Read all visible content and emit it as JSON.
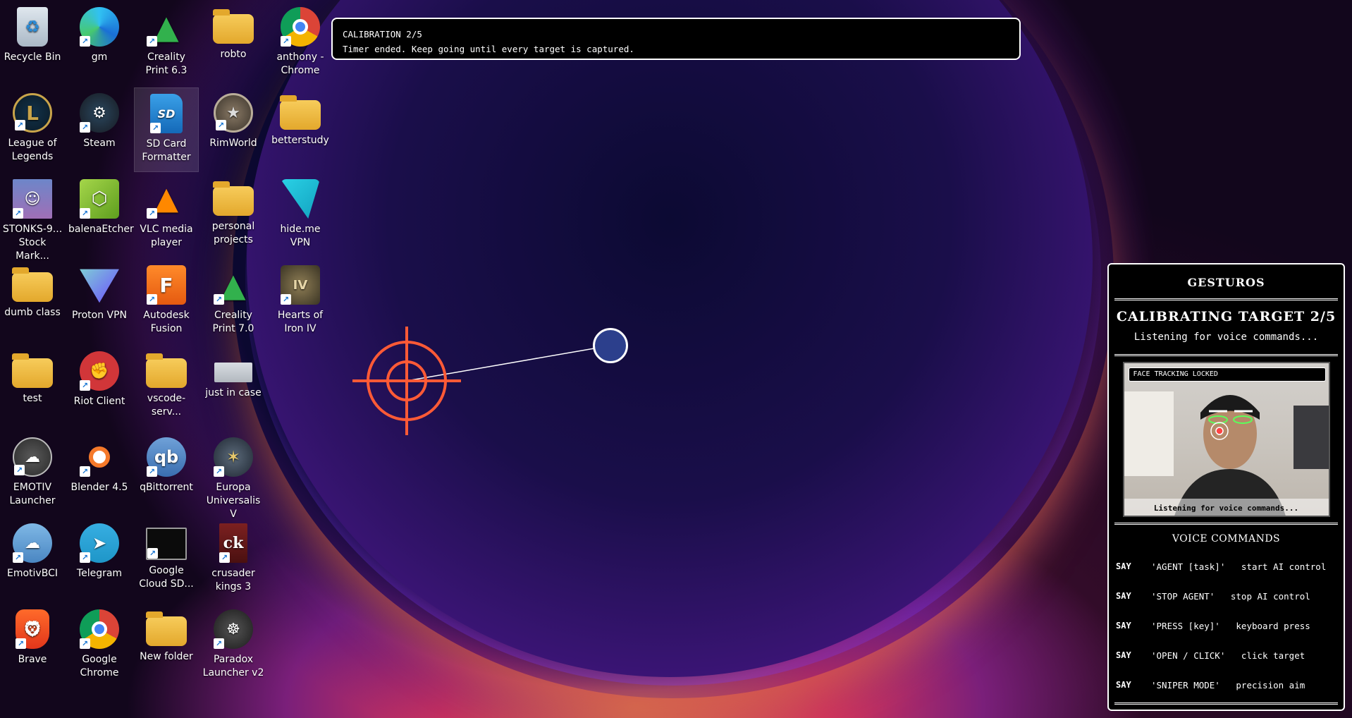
{
  "desktop": {
    "icons": [
      {
        "label": "Recycle Bin",
        "icon": "recycle-bin-icon",
        "shortcut": false
      },
      {
        "label": "gm",
        "icon": "edge-icon",
        "shortcut": true
      },
      {
        "label": "Creality Print 6.3",
        "icon": "creality-print-icon",
        "shortcut": true
      },
      {
        "label": "robto",
        "icon": "folder-icon",
        "shortcut": false
      },
      {
        "label": "anthony - Chrome",
        "icon": "chrome-icon",
        "shortcut": true
      },
      {
        "label": "League of Legends",
        "icon": "league-of-legends-icon",
        "shortcut": true
      },
      {
        "label": "Steam",
        "icon": "steam-icon",
        "shortcut": true
      },
      {
        "label": "SD Card Formatter",
        "icon": "sd-card-icon",
        "shortcut": true
      },
      {
        "label": "RimWorld",
        "icon": "rimworld-icon",
        "shortcut": true
      },
      {
        "label": "betterstudy",
        "icon": "folder-icon",
        "shortcut": false
      },
      {
        "label": "STONKS-9... Stock Mark...",
        "icon": "anime-avatar-icon",
        "shortcut": true
      },
      {
        "label": "balenaEtcher",
        "icon": "balena-etcher-icon",
        "shortcut": true
      },
      {
        "label": "VLC media player",
        "icon": "vlc-icon",
        "shortcut": true
      },
      {
        "label": "personal projects",
        "icon": "folder-icon",
        "shortcut": false
      },
      {
        "label": "hide.me VPN",
        "icon": "hide-me-vpn-icon",
        "shortcut": true
      },
      {
        "label": "dumb class",
        "icon": "folder-icon",
        "shortcut": false
      },
      {
        "label": "Proton VPN",
        "icon": "proton-vpn-icon",
        "shortcut": true
      },
      {
        "label": "Autodesk Fusion",
        "icon": "autodesk-fusion-icon",
        "shortcut": true
      },
      {
        "label": "Creality Print 7.0",
        "icon": "creality-print-icon",
        "shortcut": true
      },
      {
        "label": "Hearts of Iron IV",
        "icon": "hearts-of-iron-icon",
        "shortcut": true
      },
      {
        "label": "test",
        "icon": "folder-icon",
        "shortcut": false
      },
      {
        "label": "Riot Client",
        "icon": "riot-client-icon",
        "shortcut": true
      },
      {
        "label": "vscode-serv...",
        "icon": "zip-folder-icon",
        "shortcut": false
      },
      {
        "label": "just in case",
        "icon": "file-icon",
        "shortcut": false
      },
      {
        "label": "EMOTIV Launcher",
        "icon": "emotiv-icon",
        "shortcut": true
      },
      {
        "label": "Blender 4.5",
        "icon": "blender-icon",
        "shortcut": true
      },
      {
        "label": "qBittorrent",
        "icon": "qbittorrent-icon",
        "shortcut": true
      },
      {
        "label": "Europa Universalis V",
        "icon": "europa-universalis-icon",
        "shortcut": true
      },
      {
        "label": "EmotivBCI",
        "icon": "emotiv-bci-icon",
        "shortcut": true
      },
      {
        "label": "Telegram",
        "icon": "telegram-icon",
        "shortcut": true
      },
      {
        "label": "Google Cloud SD...",
        "icon": "google-cloud-sdk-icon",
        "shortcut": true
      },
      {
        "label": "crusader kings 3",
        "icon": "crusader-kings-icon",
        "shortcut": true
      },
      {
        "label": "Brave",
        "icon": "brave-icon",
        "shortcut": true
      },
      {
        "label": "Google Chrome",
        "icon": "chrome-icon",
        "shortcut": true
      },
      {
        "label": "New folder",
        "icon": "folder-icon",
        "shortcut": false
      },
      {
        "label": "Paradox Launcher v2",
        "icon": "paradox-launcher-icon",
        "shortcut": true
      }
    ]
  },
  "calibration_banner": {
    "title": "CALIBRATION 2/5",
    "message": "Timer ended. Keep going until every target is captured."
  },
  "overlay": {
    "target_icon": "crosshair-target-icon",
    "target_color": "#ff5a36",
    "gaze_dot_color": "#2c3f8c"
  },
  "panel": {
    "title": "GESTUROS",
    "status": "CALIBRATING TARGET 2/5",
    "listening": "Listening for voice commands...",
    "camera": {
      "tag": "FACE TRACKING LOCKED",
      "caption": "Listening for voice commands..."
    },
    "voice_commands_title": "VOICE COMMANDS",
    "commands": [
      {
        "say": "SAY",
        "phrase": "'AGENT [task]'   start AI control"
      },
      {
        "say": "SAY",
        "phrase": "'STOP AGENT'   stop AI control"
      },
      {
        "say": "SAY",
        "phrase": "'PRESS [key]'   keyboard press"
      },
      {
        "say": "SAY",
        "phrase": "'OPEN / CLICK'   click target"
      },
      {
        "say": "SAY",
        "phrase": "'SNIPER MODE'   precision aim"
      }
    ]
  }
}
